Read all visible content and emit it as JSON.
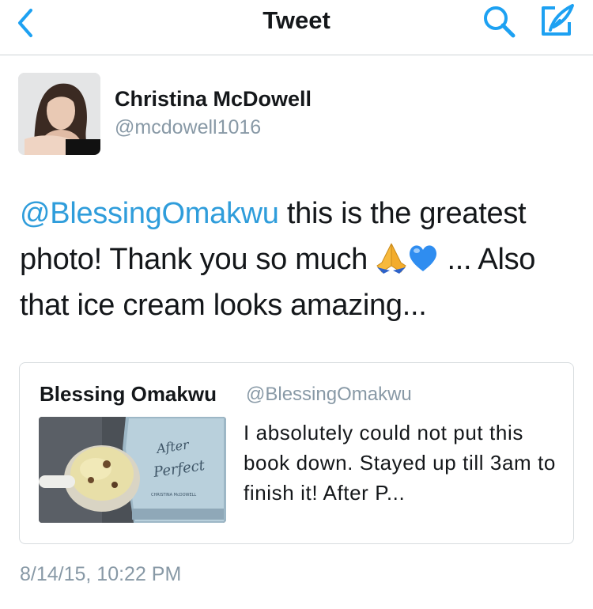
{
  "navbar": {
    "title": "Tweet",
    "back_icon": "back-chevron-icon",
    "search_icon": "search-icon",
    "compose_icon": "compose-icon",
    "accent_color": "#1da1f2"
  },
  "tweet": {
    "author": {
      "name": "Christina McDowell",
      "handle": "@mcdowell1016"
    },
    "text": {
      "mention": "@BlessingOmakwu",
      "line_part1": " this is the greatest photo! Thank you so much ",
      "emojis": [
        "folded-hands-emoji",
        "blue-heart-emoji"
      ],
      "line_part2": " ... Also that ice cream looks amazing..."
    },
    "quoted": {
      "name": "Blessing Omakwu",
      "handle": "@BlessingOmakwu",
      "text": "I absolutely could not put this book down. Stayed up till 3am to finish it! After P...",
      "media": {
        "book_title_line1": "After",
        "book_title_line2": "Perfect",
        "book_author": "CHRISTINA McDOWELL"
      }
    },
    "timestamp": "8/14/15, 10:22 PM"
  }
}
